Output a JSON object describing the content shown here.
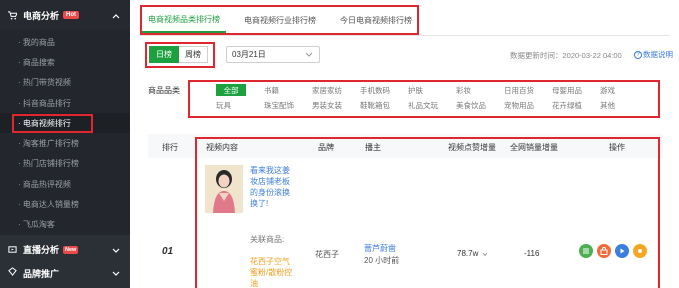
{
  "sidebar": {
    "group1": {
      "label": "电商分析",
      "badge": "Hot"
    },
    "items": [
      {
        "label": "· 我的商品"
      },
      {
        "label": "· 商品搜索"
      },
      {
        "label": "· 热门带货视频"
      },
      {
        "label": "· 抖音商品排行"
      },
      {
        "label": "· 电商视频排行"
      },
      {
        "label": "· 淘客推广排行榜"
      },
      {
        "label": "· 热门店铺排行榜"
      },
      {
        "label": "· 商品热评视频"
      },
      {
        "label": "· 电商达人销量榜"
      },
      {
        "label": "· 飞瓜淘客"
      }
    ],
    "group2": {
      "label": "直播分析",
      "badge": "New"
    },
    "group3": {
      "label": "品牌推广"
    }
  },
  "tabs": [
    {
      "label": "电商视频品类排行榜"
    },
    {
      "label": "电商视频行业排行榜"
    },
    {
      "label": "今日电商视频排行榜"
    }
  ],
  "filters": {
    "day": "日榜",
    "week": "周榜",
    "date": "03月21日",
    "updated": "数据更新时间：2020-03-22 04:00",
    "help": "数据说明"
  },
  "category": {
    "label": "商品品类",
    "items": [
      "全部",
      "书籍",
      "家居家纺",
      "手机数码",
      "护肤",
      "彩妆",
      "日用百货",
      "母婴用品",
      "游戏",
      "玩具",
      "珠宝配饰",
      "男装女装",
      "鞋靴箱包",
      "礼品文玩",
      "美食饮品",
      "宠物用品",
      "花卉绿植",
      "其他"
    ]
  },
  "table": {
    "headers": {
      "rank": "排行",
      "content": "视频内容",
      "brand": "品牌",
      "anchor": "播主",
      "views": "视频点赞增量",
      "sales": "全网销量增量",
      "ops": "操作"
    },
    "row": {
      "rank": "01",
      "title": "看来我这姜妆店铺老板的身份滚换换了!",
      "related_label": "关联商品:",
      "related_product": "花西子空气蜜粉/散粉控油",
      "brand": "花西子",
      "anchor_name": "蔷芦蔚凿",
      "anchor_time": "20 小时前",
      "views": "78.7w",
      "sales": "-116"
    }
  },
  "colors": {
    "accent": "#1ca040",
    "highlight": "#e0262e",
    "link": "#3c7ee0",
    "sidebar": "#2b2f36"
  }
}
